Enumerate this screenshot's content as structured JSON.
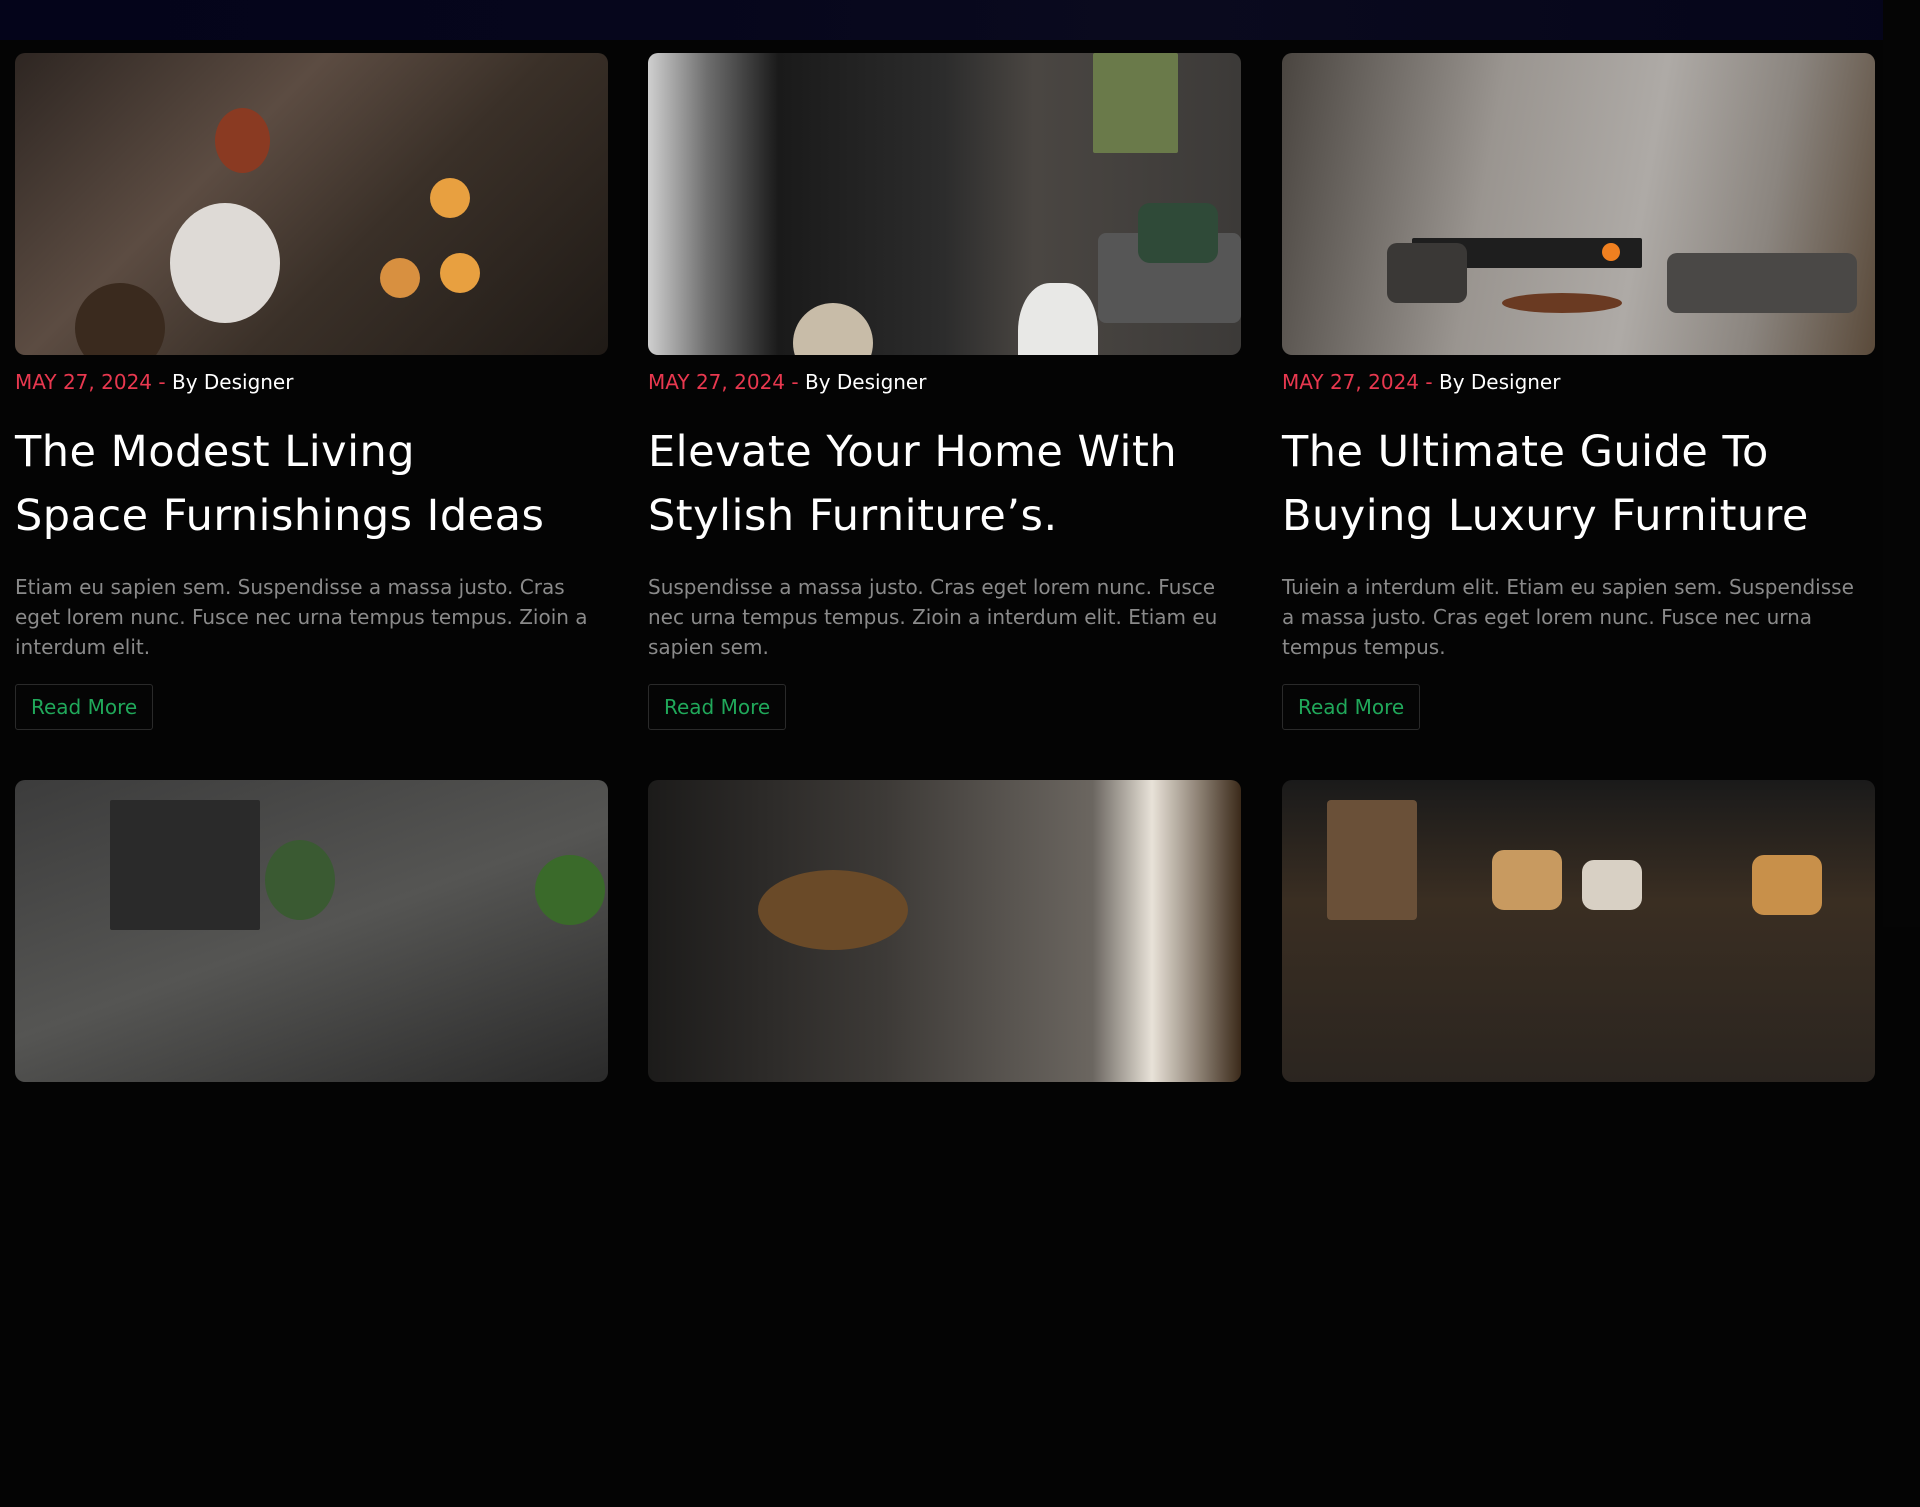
{
  "posts": [
    {
      "image": "candles-book-cocoa-photo",
      "date": "MAY 27, 2024",
      "separator": "-",
      "author": "By Designer",
      "title_line1": "The Modest Living",
      "title_line2": "Space Furnishings Ideas",
      "excerpt": "Etiam eu sapien sem. Suspendisse a massa justo. Cras eget lorem nunc. Fusce nec urna tempus tempus. Zioin a interdum elit.",
      "button": "Read More"
    },
    {
      "image": "stone-wall-living-room-photo",
      "date": "MAY 27, 2024",
      "separator": "-",
      "author": "By Designer",
      "title_line1": "Elevate Your Home With",
      "title_line2": "Stylish Furniture’s.",
      "excerpt": "Suspendisse a massa justo. Cras eget lorem nunc. Fusce nec urna tempus tempus. Zioin a interdum elit. Etiam eu sapien sem.",
      "button": "Read More"
    },
    {
      "image": "marble-fireplace-lounge-photo",
      "date": "MAY 27, 2024",
      "separator": "-",
      "author": "By Designer",
      "title_line1": "The Ultimate Guide To",
      "title_line2": "Buying Luxury Furniture",
      "excerpt": "Tuiein a interdum elit. Etiam eu sapien sem. Suspendisse a massa justo. Cras eget lorem nunc. Fusce nec urna tempus tempus.",
      "button": "Read More"
    }
  ],
  "row2_images": [
    "plant-shelf-room-photo",
    "dried-flowers-sunlit-room-photo",
    "pillows-sofa-room-photo"
  ],
  "colors": {
    "background": "#040404",
    "date_accent": "#e8384f",
    "button_text": "#20a85a",
    "excerpt_text": "#8a8a8a",
    "title_text": "#ffffff"
  }
}
